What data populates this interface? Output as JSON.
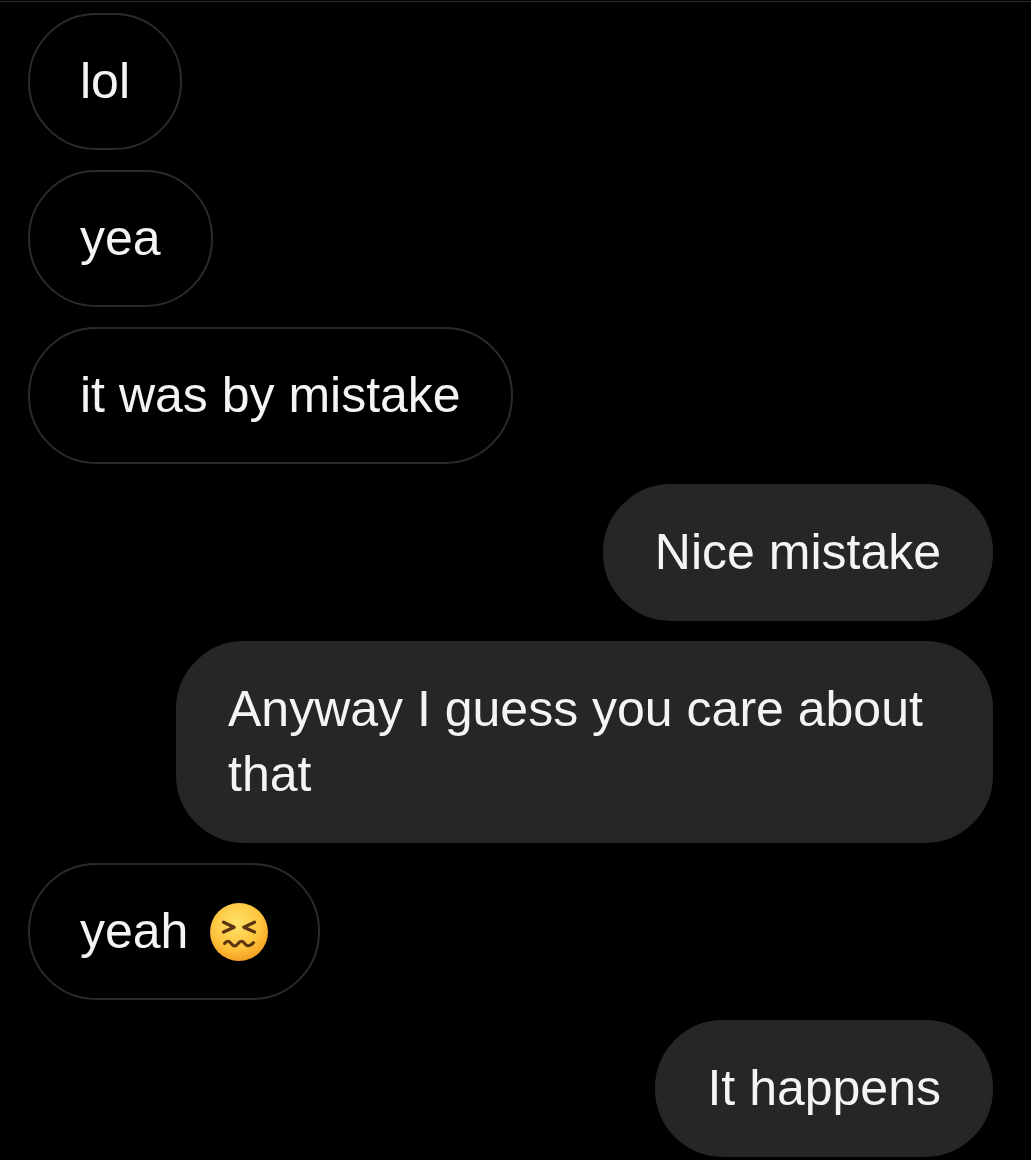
{
  "messages": [
    {
      "kind": "received",
      "text": "lol",
      "emoji": false
    },
    {
      "kind": "received",
      "text": "yea",
      "emoji": false
    },
    {
      "kind": "received",
      "text": "it was by mistake",
      "emoji": false
    },
    {
      "kind": "sent",
      "text": "Nice mistake",
      "emoji": false
    },
    {
      "kind": "sent",
      "text": "Anyway I guess you care about that",
      "emoji": false
    },
    {
      "kind": "received",
      "text": "yeah",
      "emoji": true
    },
    {
      "kind": "sent",
      "text": "It happens",
      "emoji": false
    }
  ]
}
